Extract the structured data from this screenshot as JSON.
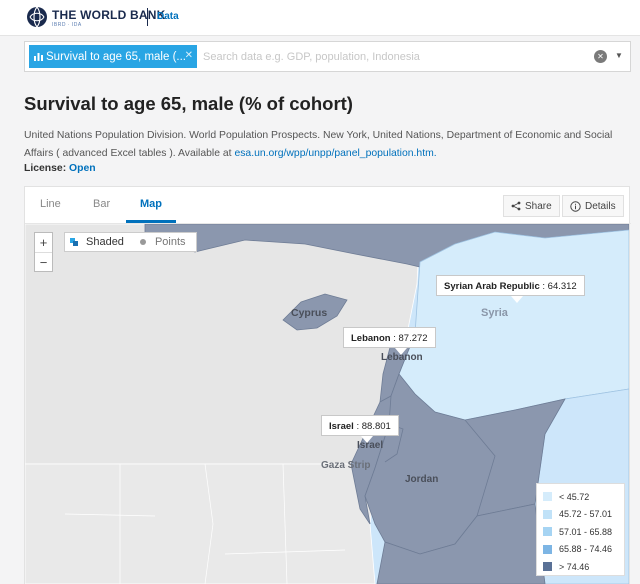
{
  "header": {
    "brand": "THE WORLD BANK",
    "brand_sub": "IBRD · IDA",
    "data_link": "Data"
  },
  "search": {
    "chip_label": "Survival to age 65, male (...",
    "placeholder": "Search data e.g. GDP, population, Indonesia"
  },
  "indicator": {
    "title": "Survival to age 65, male (% of cohort)",
    "source_text": "United Nations Population Division. World Population Prospects. New York, United Nations, Department of Economic and Social Affairs ( advanced Excel tables ). Available at ",
    "source_link": "esa.un.org/wpp/unpp/panel_population.htm.",
    "license_label": "License:",
    "license_value": "Open"
  },
  "tabs": [
    {
      "label": "Line",
      "active": false
    },
    {
      "label": "Bar",
      "active": false
    },
    {
      "label": "Map",
      "active": true
    }
  ],
  "actions": {
    "share": "Share",
    "details": "Details"
  },
  "map": {
    "zoom_in": "+",
    "zoom_out": "−",
    "mode_shaded": "Shaded",
    "mode_points": "Points",
    "labels": {
      "cyprus": "Cyprus",
      "syria": "Syria",
      "lebanon": "Lebanon",
      "gaza": "Gaza Strip",
      "jordan": "Jordan",
      "israel": "Israel"
    },
    "tooltips": [
      {
        "country": "Syrian Arab Republic",
        "value": "64.312"
      },
      {
        "country": "Lebanon",
        "value": "87.272"
      },
      {
        "country": "Israel",
        "value": "88.801"
      }
    ],
    "legend": [
      {
        "label": "< 45.72",
        "color": "#d5ecfb"
      },
      {
        "label": "45.72 - 57.01",
        "color": "#c1e2f8"
      },
      {
        "label": "57.01 - 65.88",
        "color": "#a6d4f3"
      },
      {
        "label": "65.88 - 74.46",
        "color": "#7db5e4"
      },
      {
        "label": "> 74.46",
        "color": "#5a7196"
      }
    ]
  },
  "colors": {
    "accent": "#0071bc",
    "chip": "#29a5e4",
    "land_nodata": "#e6e6e6",
    "syria_fill": "#d5ecfb",
    "high_fill": "#8a96ae"
  }
}
